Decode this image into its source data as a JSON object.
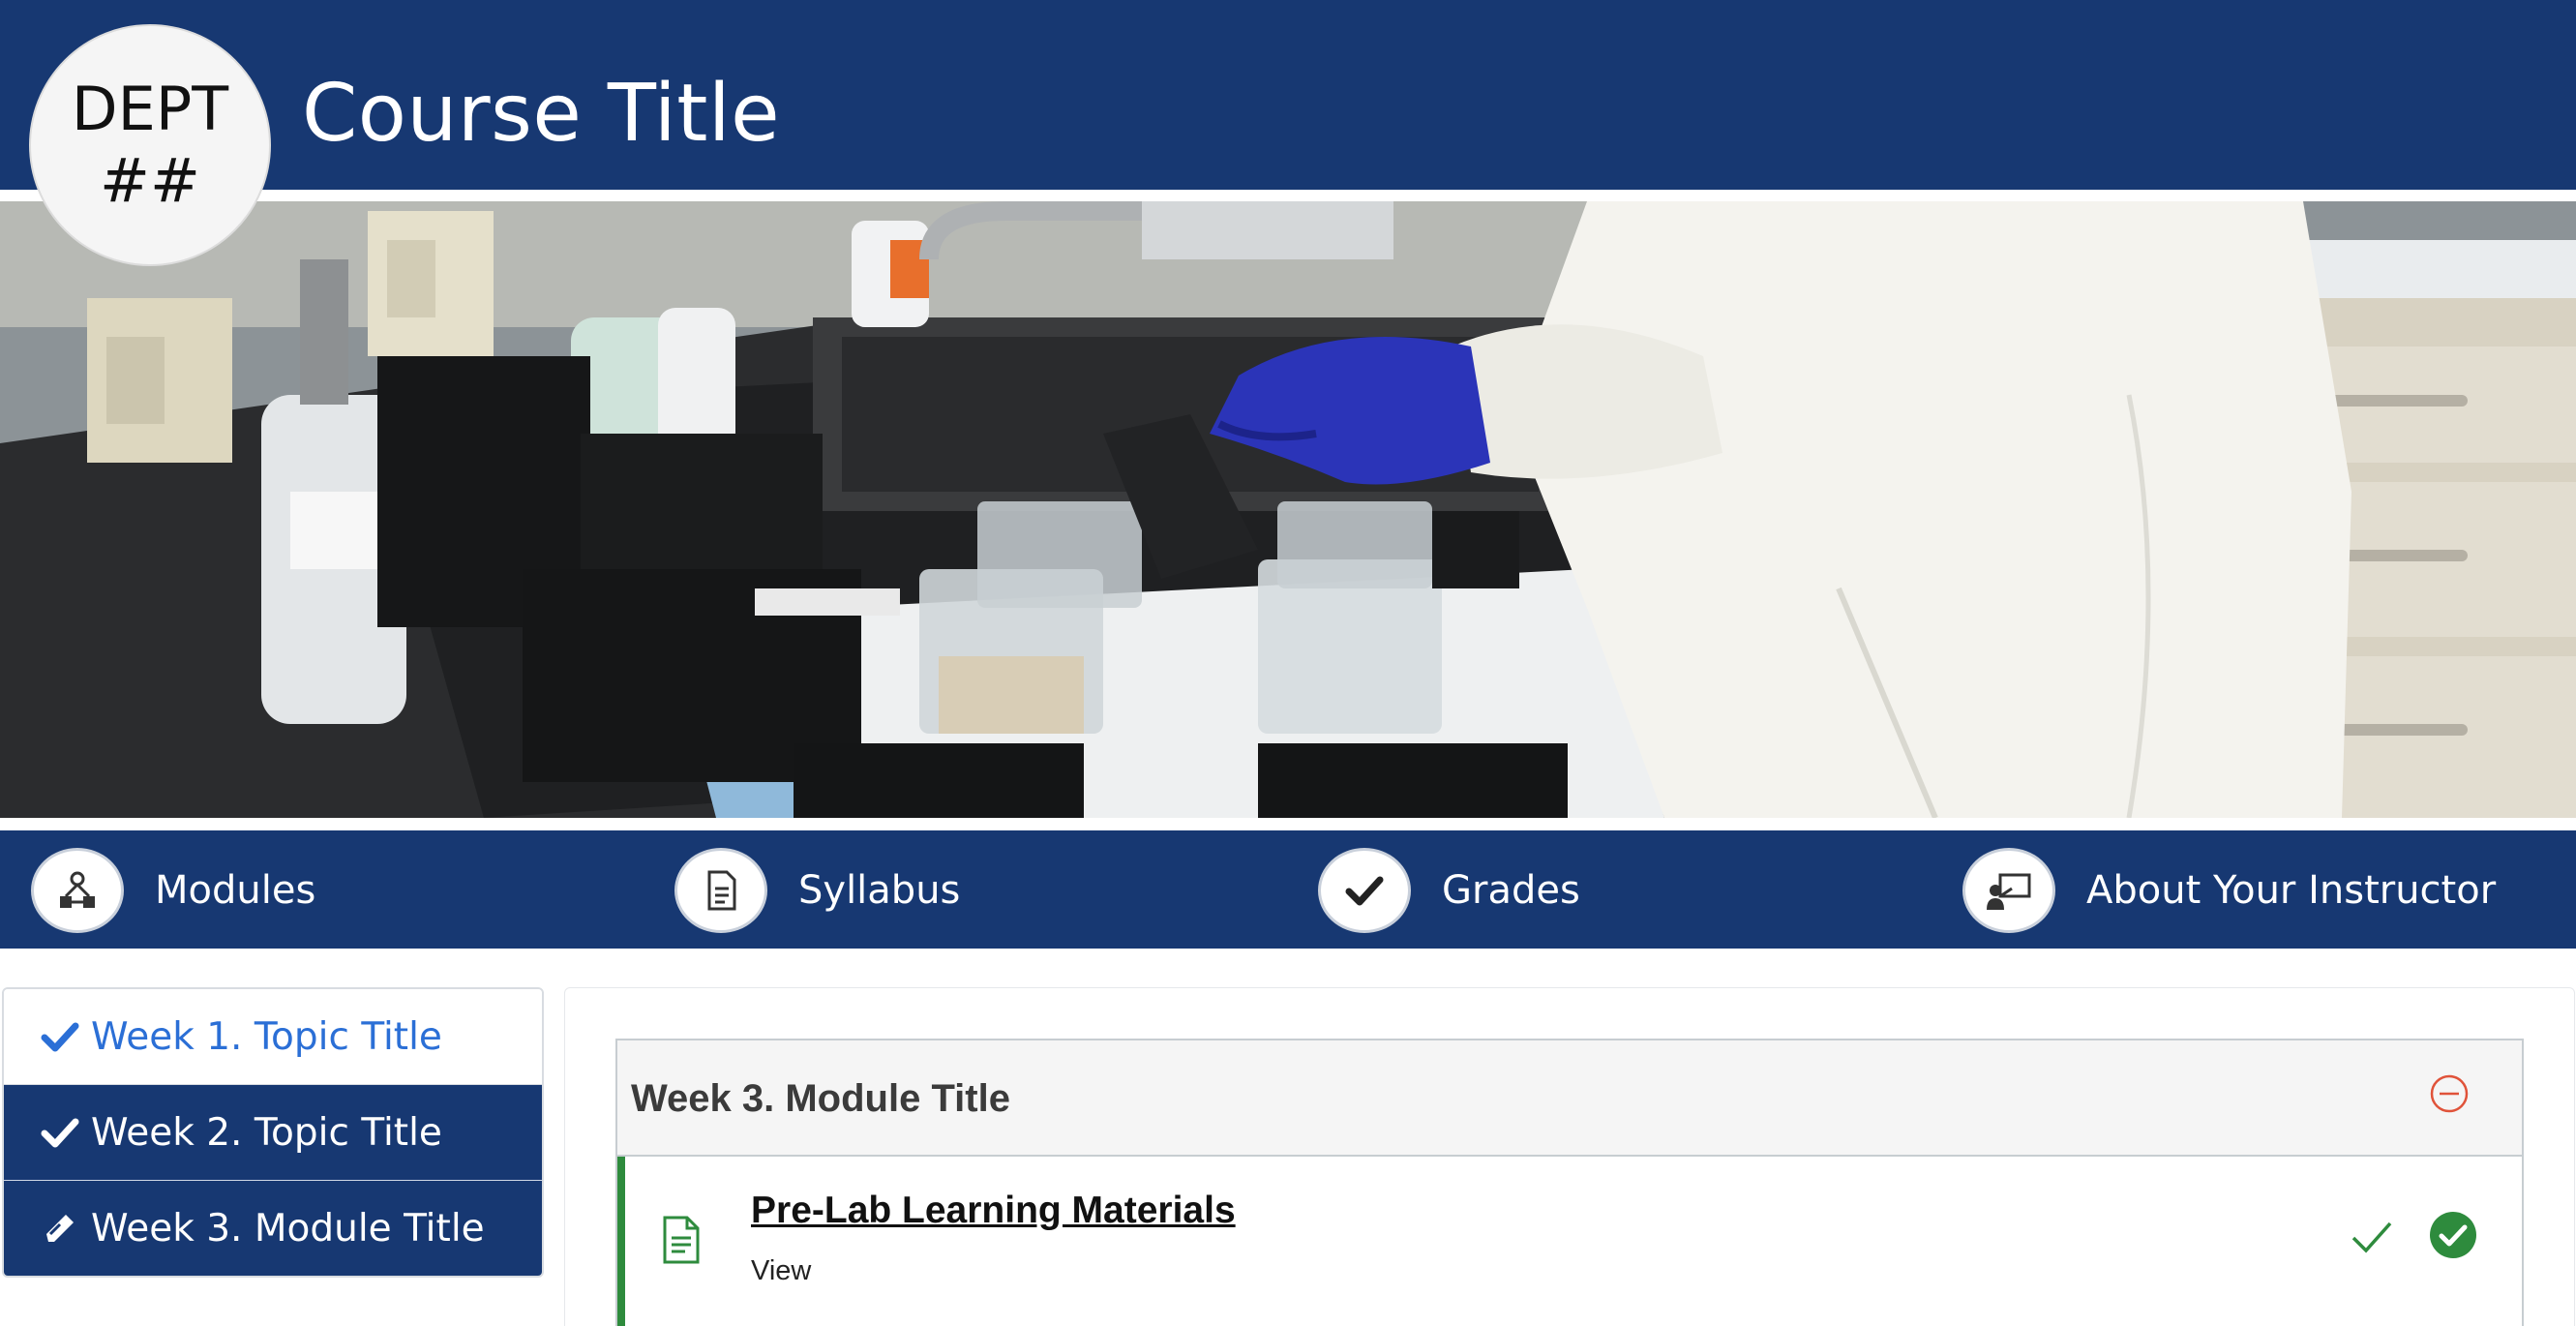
{
  "header": {
    "badge_line1": "DEPT",
    "badge_line2": "##",
    "course_title": "Course Title",
    "background_color": "#173872"
  },
  "hero": {
    "icon": "lab-photo-image"
  },
  "nav": {
    "items": [
      {
        "label": "Modules",
        "icon": "modules-icon"
      },
      {
        "label": "Syllabus",
        "icon": "document-icon"
      },
      {
        "label": "Grades",
        "icon": "checkmark-icon"
      },
      {
        "label": "About Your Instructor",
        "icon": "instructor-icon"
      }
    ]
  },
  "sidebar": {
    "items": [
      {
        "label": "Week 1. Topic Title",
        "icon": "checkmark-icon",
        "state": "active"
      },
      {
        "label": "Week 2. Topic Title",
        "icon": "checkmark-icon",
        "state": "default"
      },
      {
        "label": "Week 3. Module Title",
        "icon": "pencil-icon",
        "state": "default"
      }
    ]
  },
  "module": {
    "title": "Week 3. Module Title",
    "collapse_icon": "minus-circle-icon",
    "items": [
      {
        "title": "Pre-Lab Learning Materials",
        "requirement": "View",
        "icon": "page-icon",
        "status_icons": [
          "checkmark-icon",
          "completed-circle-icon"
        ]
      }
    ]
  },
  "colors": {
    "brand_navy": "#173872",
    "active_blue": "#2b6fd6",
    "complete_green": "#2e8b3d",
    "collapse_orange": "#e0533a"
  }
}
